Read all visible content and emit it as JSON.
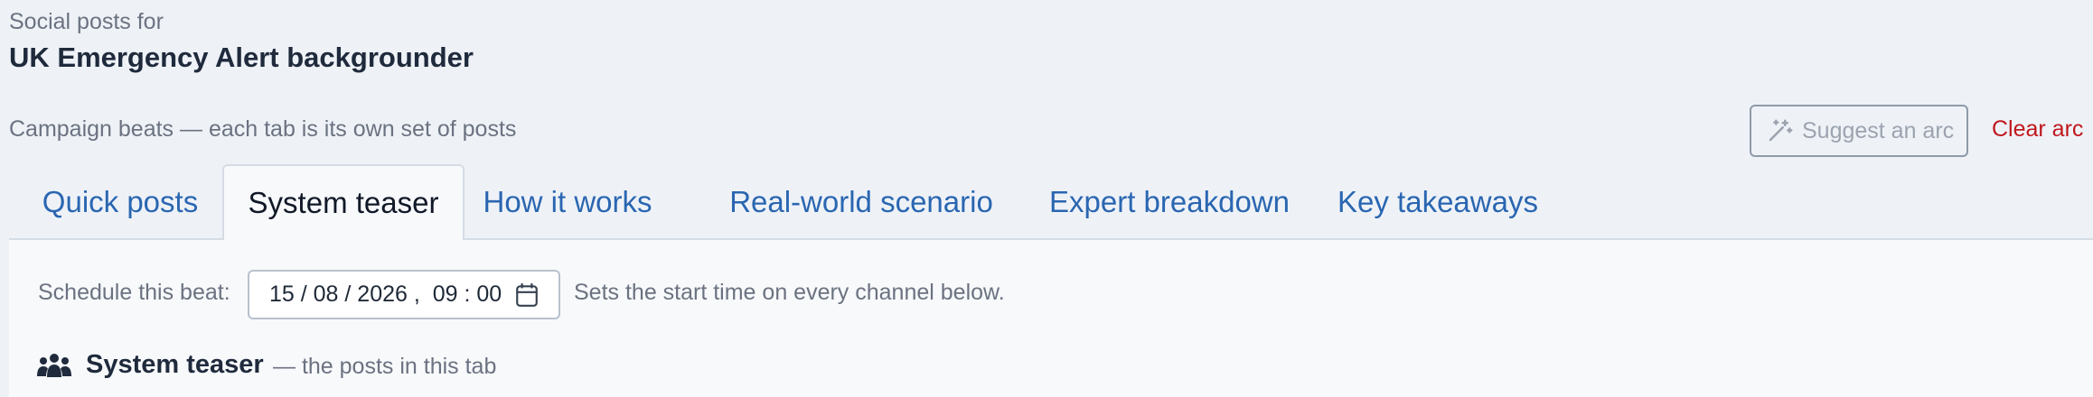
{
  "header": {
    "kicker": "Social posts for",
    "title": "UK Emergency Alert backgrounder"
  },
  "campaign": {
    "description": "Campaign beats — each tab is its own set of posts",
    "suggest_label": "Suggest an arc",
    "clear_label": "Clear arc"
  },
  "tabs": [
    {
      "label": "Quick posts",
      "active": false
    },
    {
      "label": "System teaser",
      "active": true
    },
    {
      "label": "How it works",
      "active": false
    },
    {
      "label": "Real-world scenario",
      "active": false
    },
    {
      "label": "Expert breakdown",
      "active": false
    },
    {
      "label": "Key takeaways",
      "active": false
    }
  ],
  "schedule": {
    "label": "Schedule this beat:",
    "value": "15 / 08 / 2026 ,  09 : 00",
    "help": "Sets the start time on every channel below."
  },
  "section": {
    "icon": "people-group-icon",
    "title": "System teaser",
    "subtitle": "— the posts in this tab"
  },
  "colors": {
    "accent": "#2a66b1",
    "danger": "#c0171c",
    "text": "#1f2a3c",
    "muted": "#6b7280"
  }
}
